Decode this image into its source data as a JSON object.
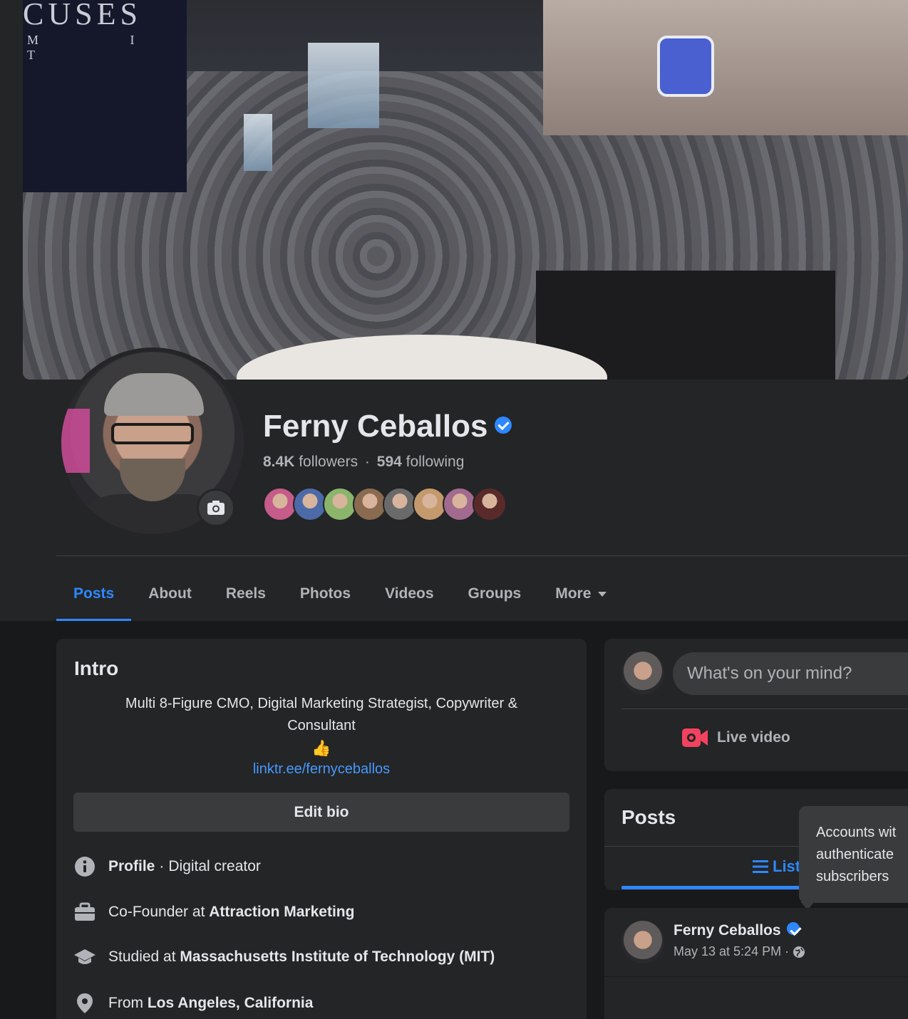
{
  "cover": {
    "banner_text": "CUSES",
    "banner_sub": "M I T"
  },
  "profile": {
    "name": "Ferny Ceballos",
    "followers": "8.4K",
    "followers_label": "followers",
    "following": "594",
    "following_label": "following"
  },
  "friend_faces": [
    "#c55c8a",
    "#4c6aa8",
    "#8bb56a",
    "#8a6b50",
    "#6a6a6a",
    "#c49a6c",
    "#a26a8e",
    "#5a2a2a"
  ],
  "tabs": [
    {
      "label": "Posts",
      "active": true
    },
    {
      "label": "About"
    },
    {
      "label": "Reels"
    },
    {
      "label": "Photos"
    },
    {
      "label": "Videos"
    },
    {
      "label": "Groups"
    },
    {
      "label": "More"
    }
  ],
  "intro": {
    "title": "Intro",
    "bio_line1": "Multi 8-Figure CMO, Digital Marketing Strategist, Copywriter &",
    "bio_line2": "Consultant",
    "emoji": "👍",
    "link": "linktr.ee/fernyceballos",
    "edit_bio": "Edit bio",
    "rows": {
      "profile_label": "Profile",
      "profile_sep": "·",
      "profile_value": "Digital creator",
      "work_prefix": "Co-Founder at",
      "work_value": "Attraction Marketing",
      "edu_prefix": "Studied at",
      "edu_value": "Massachusetts Institute of Technology (MIT)",
      "from_prefix": "From",
      "from_value": "Los Angeles, California"
    }
  },
  "composer": {
    "placeholder": "What's on your mind?",
    "live_video": "Live video"
  },
  "posts": {
    "title": "Posts",
    "list_view": "List"
  },
  "tooltip": {
    "line1": "Accounts wit",
    "line2": "authenticate",
    "line3": "subscribers"
  },
  "post": {
    "author": "Ferny Ceballos",
    "time": "May 13 at 5:24 PM",
    "sep": "·"
  },
  "colors": {
    "accent": "#2d88ff",
    "live_red": "#f3425f",
    "background": "#18191a",
    "card": "#242526"
  }
}
